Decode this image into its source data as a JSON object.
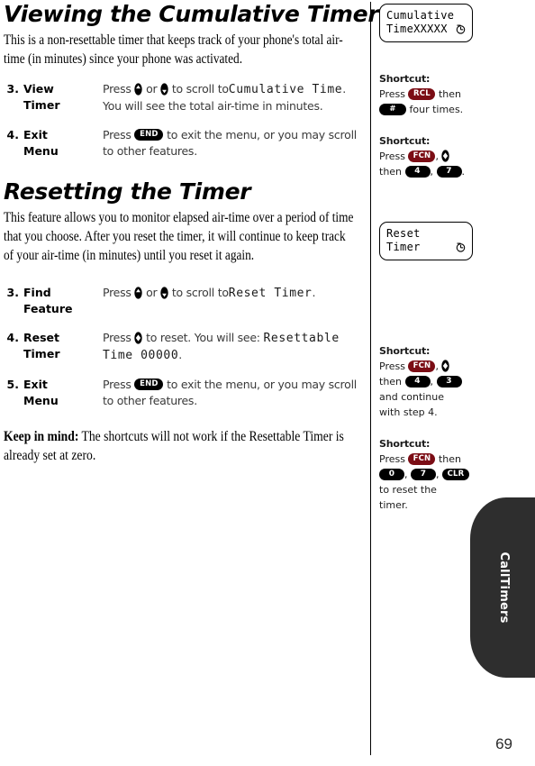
{
  "page": {
    "number": "69",
    "thumb_tab_label": "CallTimers"
  },
  "sections": [
    {
      "heading": "Viewing the Cumulative Timer",
      "intro": "This is a non-resettable timer that keeps track of your phone's total air-time (in minutes) since your phone was activated.",
      "steps": [
        {
          "number": "3.",
          "label_line1": "View",
          "label_line2": "Timer",
          "desc_line1_pre": "Press",
          "desc_line1_mid": "or",
          "desc_line1_post": "to scroll to",
          "desc_line1_lcd": "Cumulative Time",
          "desc_line1_end": ".",
          "desc_line2": "You will see the total air-time in minutes."
        },
        {
          "number": "4.",
          "label_line1": "Exit",
          "label_line2": "Menu",
          "desc_line1_pre": "Press",
          "desc_line1_key": "END",
          "desc_line1_post": "to exit the menu, or you may scroll",
          "desc_line2": "to other features."
        }
      ]
    },
    {
      "heading": "Resetting the Timer",
      "intro": "This feature allows you to monitor elapsed air-time over a period of time that you choose. After you reset the timer, it will continue to keep track of your air-time (in minutes) until you reset it again.",
      "steps": [
        {
          "number": "3.",
          "label_line1": "Find",
          "label_line2": "Feature",
          "desc_line1_pre": "Press",
          "desc_line1_mid": "or",
          "desc_line1_post": "to scroll to",
          "desc_line1_lcd": "Reset Timer",
          "desc_line1_end": "."
        },
        {
          "number": "4.",
          "label_line1": "Reset",
          "label_line2": "Timer",
          "desc_line1_pre": "Press",
          "desc_line1_post": "to reset. You will see:",
          "desc_line1_lcd": "Resettable",
          "desc_line2_lcd": "Time 00000",
          "desc_line2_end": "."
        },
        {
          "number": "5.",
          "label_line1": "Exit",
          "label_line2": "Menu",
          "desc_line1_pre": "Press",
          "desc_line1_key": "END",
          "desc_line1_post": "to exit the menu, or you may scroll",
          "desc_line2": "to other features."
        }
      ]
    }
  ],
  "keep_in_mind": {
    "label": "Keep in mind:",
    "text": " The shortcuts will not work if the Resettable Timer is already set at zero."
  },
  "sidebar": {
    "displays": [
      {
        "name": "cumulative-timer-display",
        "line1": "Cumulative",
        "line2": "TimeXXXXX",
        "icon": "clock-icon"
      },
      {
        "name": "reset-timer-display",
        "line1": "Reset",
        "line2": "Timer",
        "icon": "clock-icon"
      }
    ],
    "shortcuts": [
      {
        "title": "Shortcut:",
        "row1_pre": "Press",
        "row1_key": "RCL",
        "row1_post": "then",
        "row2_key": "#",
        "row2_post": "four times."
      },
      {
        "title": "Shortcut:",
        "row1_pre": "Press",
        "row1_key": "FCN",
        "row1_sep": ",",
        "row2_pre": "then",
        "row2_key1": "4",
        "row2_sep": ",",
        "row2_key2": "7",
        "row2_end": "."
      },
      {
        "title": "Shortcut:",
        "row1_pre": "Press",
        "row1_key": "FCN",
        "row1_sep": ",",
        "row2_pre": "then",
        "row2_key1": "4",
        "row2_sep": ",",
        "row2_key2": "3",
        "row3": "and continue",
        "row4": "with step 4."
      },
      {
        "title": "Shortcut:",
        "row1_pre": "Press",
        "row1_key": "FCN",
        "row1_post": "then",
        "row2_key1": "0",
        "row2_sep1": ",",
        "row2_key2": "7",
        "row2_sep2": ",",
        "row2_key3": "CLR",
        "row3": "to reset the",
        "row4": "timer."
      }
    ]
  },
  "colors": {
    "key_black": "#000000",
    "key_red": "#7b0d15",
    "tab_dark": "#2e2e2e"
  }
}
